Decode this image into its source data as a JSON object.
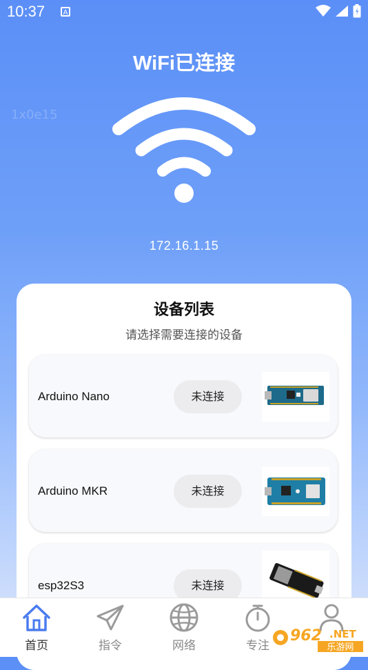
{
  "status_bar": {
    "time": "10:37",
    "notification_glyph": "A"
  },
  "header": {
    "title": "WiFi已连接",
    "watermark": "1x0e15",
    "ip": "172.16.1.15"
  },
  "device_panel": {
    "title": "设备列表",
    "subtitle": "请选择需要连接的设备",
    "devices": [
      {
        "name": "Arduino Nano",
        "status": "未连接"
      },
      {
        "name": "Arduino MKR",
        "status": "未连接"
      },
      {
        "name": "esp32S3",
        "status": "未连接"
      }
    ]
  },
  "tabs": [
    {
      "label": "首页",
      "icon": "home-icon",
      "active": true
    },
    {
      "label": "指令",
      "icon": "send-icon"
    },
    {
      "label": "网络",
      "icon": "globe-icon"
    },
    {
      "label": "专注",
      "icon": "timer-icon"
    },
    {
      "label": "",
      "icon": "user-icon"
    }
  ],
  "corner_badge": {
    "text_top": "962",
    "text_net": "NET",
    "text_bottom": "乐游网"
  },
  "colors": {
    "accent": "#5b8ff7",
    "tab_active": "#4a7cf0",
    "tab_inactive": "#9a9a9a"
  }
}
